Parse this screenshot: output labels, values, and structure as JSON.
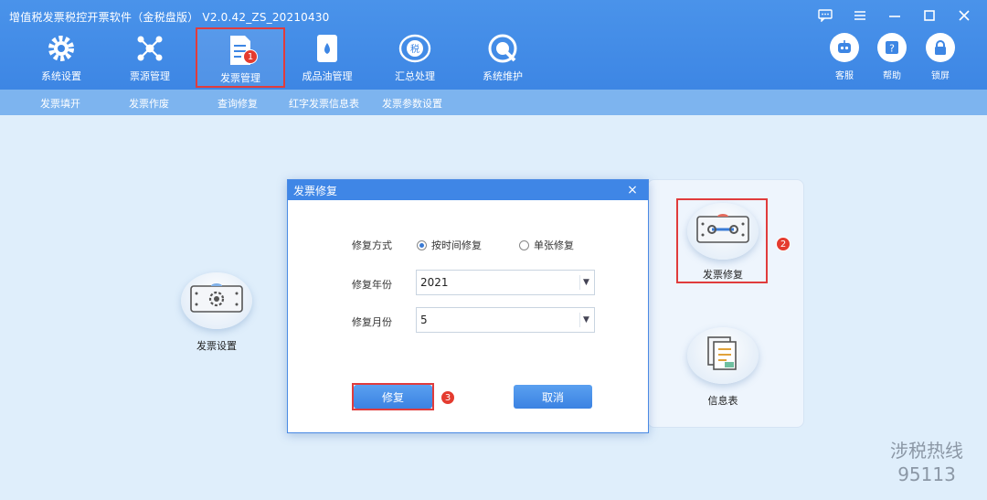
{
  "app": {
    "title": "增值税发票税控开票软件（金税盘版） V2.0.42_ZS_20210430",
    "accent": "#3d86e4",
    "window_controls": [
      "message-icon",
      "menu-icon",
      "minimize-icon",
      "maximize-icon",
      "close-icon"
    ]
  },
  "toolbar": {
    "items": [
      {
        "label": "系统设置",
        "icon": "gear-icon"
      },
      {
        "label": "票源管理",
        "icon": "network-icon"
      },
      {
        "label": "发票管理",
        "icon": "invoice-doc-icon",
        "active": true,
        "badge": "1"
      },
      {
        "label": "成品油管理",
        "icon": "oil-drum-icon"
      },
      {
        "label": "汇总处理",
        "icon": "tax-summary-icon"
      },
      {
        "label": "系统维护",
        "icon": "wrench-icon"
      }
    ],
    "right": [
      {
        "label": "客服",
        "icon": "robot-icon"
      },
      {
        "label": "帮助",
        "icon": "help-icon"
      },
      {
        "label": "锁屏",
        "icon": "lock-icon"
      }
    ]
  },
  "submenu": [
    "发票填开",
    "发票作废",
    "查询修复",
    "红字发票信息表",
    "发票参数设置"
  ],
  "cards": {
    "left": {
      "label": "发票设置",
      "icon": "invoice-settings-icon"
    },
    "repair": {
      "label": "发票修复",
      "icon": "invoice-repair-icon",
      "badge": "2"
    },
    "info": {
      "label": "信息表",
      "icon": "info-sheet-icon"
    }
  },
  "dialog": {
    "title": "发票修复",
    "close": "×",
    "mode_label": "修复方式",
    "mode_options": [
      {
        "label": "按时间修复",
        "selected": true
      },
      {
        "label": "单张修复",
        "selected": false
      }
    ],
    "year_label": "修复年份",
    "year_value": "2021",
    "month_label": "修复月份",
    "month_value": "5",
    "repair_button": "修复",
    "repair_badge": "3",
    "cancel_button": "取消"
  },
  "watermark": {
    "line1": "涉税热线",
    "line2": "95113"
  }
}
